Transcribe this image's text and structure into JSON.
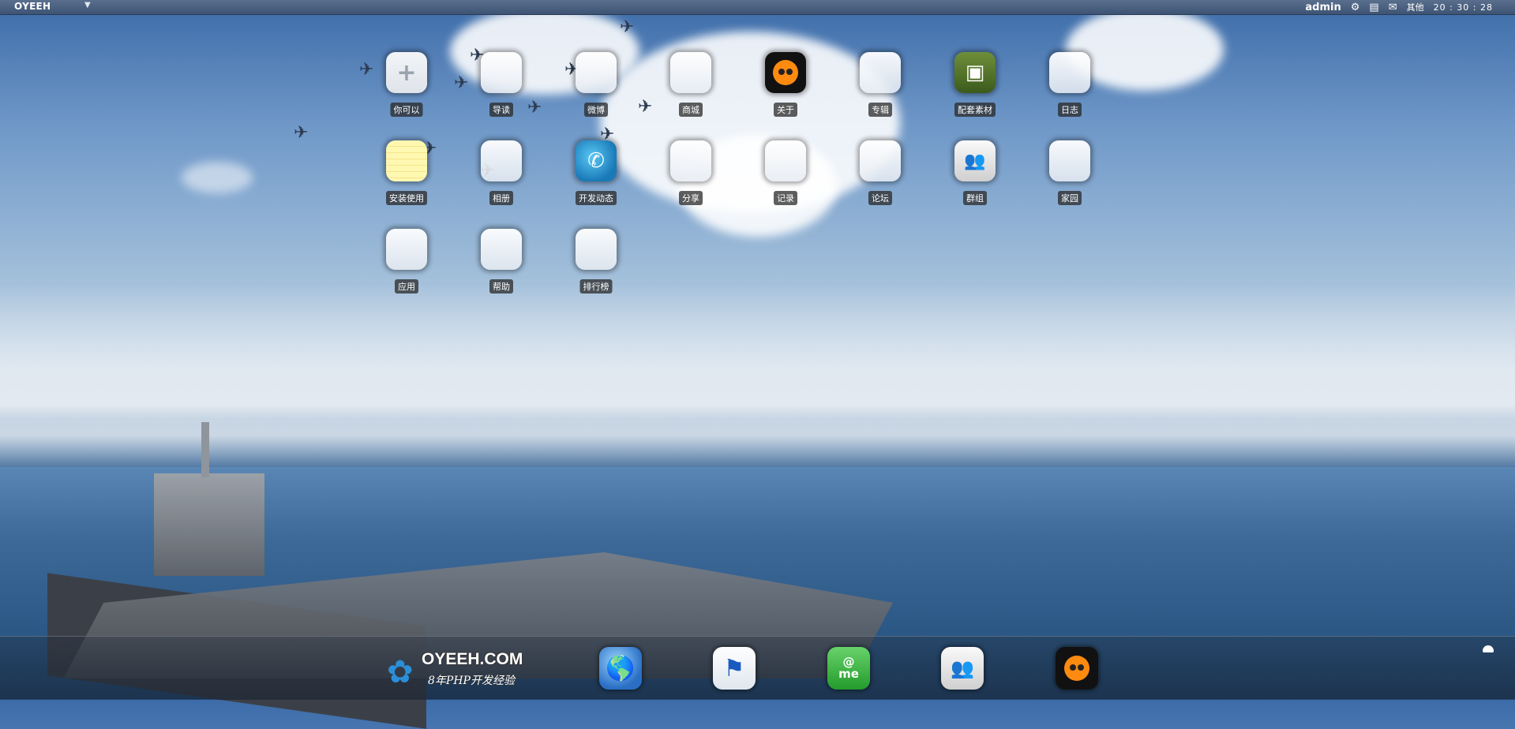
{
  "topbar": {
    "brand": "OYEEH",
    "user": "admin",
    "other": "其他",
    "clock": "20 : 30 : 28",
    "icons": [
      "caret-down-icon",
      "gear-icon",
      "book-icon",
      "chat-icon"
    ]
  },
  "apps": [
    {
      "label": "你可以",
      "icon": "add-icon"
    },
    {
      "label": "导读",
      "icon": "blank-icon"
    },
    {
      "label": "微博",
      "icon": "blank-icon"
    },
    {
      "label": "商城",
      "icon": "blank-icon"
    },
    {
      "label": "关于",
      "icon": "orange-face-icon"
    },
    {
      "label": "专辑",
      "icon": "blank-icon"
    },
    {
      "label": "配套素材",
      "icon": "green-box-icon"
    },
    {
      "label": "日志",
      "icon": "blank-icon"
    },
    {
      "label": "安装使用",
      "icon": "notepad-icon"
    },
    {
      "label": "相册",
      "icon": "blank-icon"
    },
    {
      "label": "开发动态",
      "icon": "phone-icon"
    },
    {
      "label": "分享",
      "icon": "blank-icon"
    },
    {
      "label": "记录",
      "icon": "blank-icon"
    },
    {
      "label": "论坛",
      "icon": "blank-icon"
    },
    {
      "label": "群组",
      "icon": "group-icon"
    },
    {
      "label": "家园",
      "icon": "blank-icon"
    },
    {
      "label": "应用",
      "icon": "blank-icon"
    },
    {
      "label": "帮助",
      "icon": "blank-icon"
    },
    {
      "label": "排行榜",
      "icon": "blank-icon"
    }
  ],
  "dock": {
    "logo_text": "OYEEH.COM",
    "logo_sub": "8年PHP开发经验",
    "me_label": "me",
    "me_at": "@",
    "items": [
      "globe-icon",
      "flag-icon",
      "me-icon",
      "group-icon",
      "orange-face-icon"
    ]
  }
}
